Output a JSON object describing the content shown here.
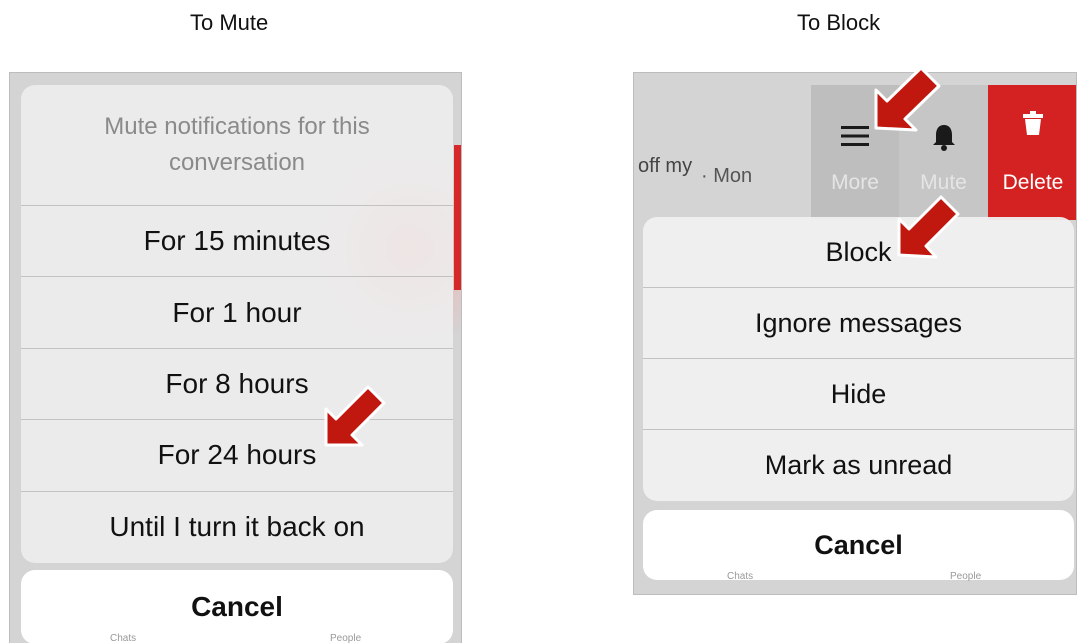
{
  "captions": {
    "left": "To Mute",
    "right": "To Block"
  },
  "mute_sheet": {
    "header": "Mute notifications for this conversation",
    "options": [
      {
        "label": "For 15 minutes"
      },
      {
        "label": "For 1 hour"
      },
      {
        "label": "For 8 hours"
      },
      {
        "label": "For 24 hours"
      },
      {
        "label": "Until I turn it back on"
      }
    ],
    "cancel_label": "Cancel",
    "bottom_tabs": [
      "Chats",
      "People"
    ]
  },
  "block_screen": {
    "conversation_preview": {
      "text": "off my",
      "time": "· Mon"
    },
    "swipe_actions": {
      "more_label": "More",
      "more_icon": "hamburger-menu-icon",
      "mute_label": "Mute",
      "mute_icon": "bell-icon",
      "delete_label": "Delete",
      "delete_icon": "trash-icon"
    },
    "options": [
      {
        "label": "Block"
      },
      {
        "label": "Ignore messages"
      },
      {
        "label": "Hide"
      },
      {
        "label": "Mark as unread"
      }
    ],
    "cancel_label": "Cancel",
    "bottom_tabs": [
      "Chats",
      "People"
    ]
  },
  "colors": {
    "delete_red": "#d42222",
    "annotation_arrow": "#c0170f",
    "sheet_bg": "#eeeeee"
  }
}
